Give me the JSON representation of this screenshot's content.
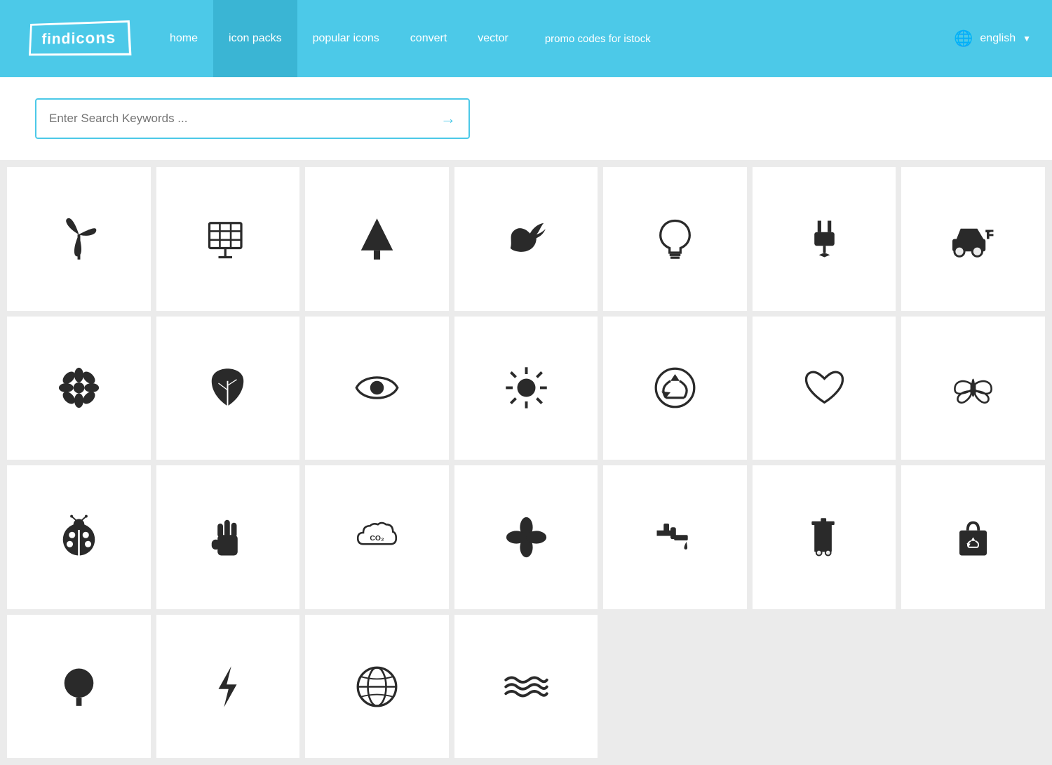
{
  "nav": {
    "logo": "findicons",
    "items": [
      {
        "label": "home",
        "active": false
      },
      {
        "label": "icon packs",
        "active": true
      },
      {
        "label": "popular icons",
        "active": false
      },
      {
        "label": "convert",
        "active": false
      },
      {
        "label": "vector",
        "active": false
      }
    ],
    "promo": "promo codes for istock",
    "language": "english"
  },
  "search": {
    "placeholder": "Enter Search Keywords ..."
  },
  "icons": [
    "wind-turbine",
    "solar-panel",
    "tree",
    "bird",
    "lightbulb",
    "plug",
    "electric-car",
    "flower",
    "leaf",
    "eye",
    "sun",
    "recycle",
    "heart",
    "butterfly",
    "ladybug",
    "hand",
    "co2-cloud",
    "four-leaf",
    "faucet",
    "trash-bin",
    "recycle-bag",
    "tree-round",
    "lightning",
    "globe",
    "waves",
    "empty",
    "empty",
    "empty"
  ]
}
